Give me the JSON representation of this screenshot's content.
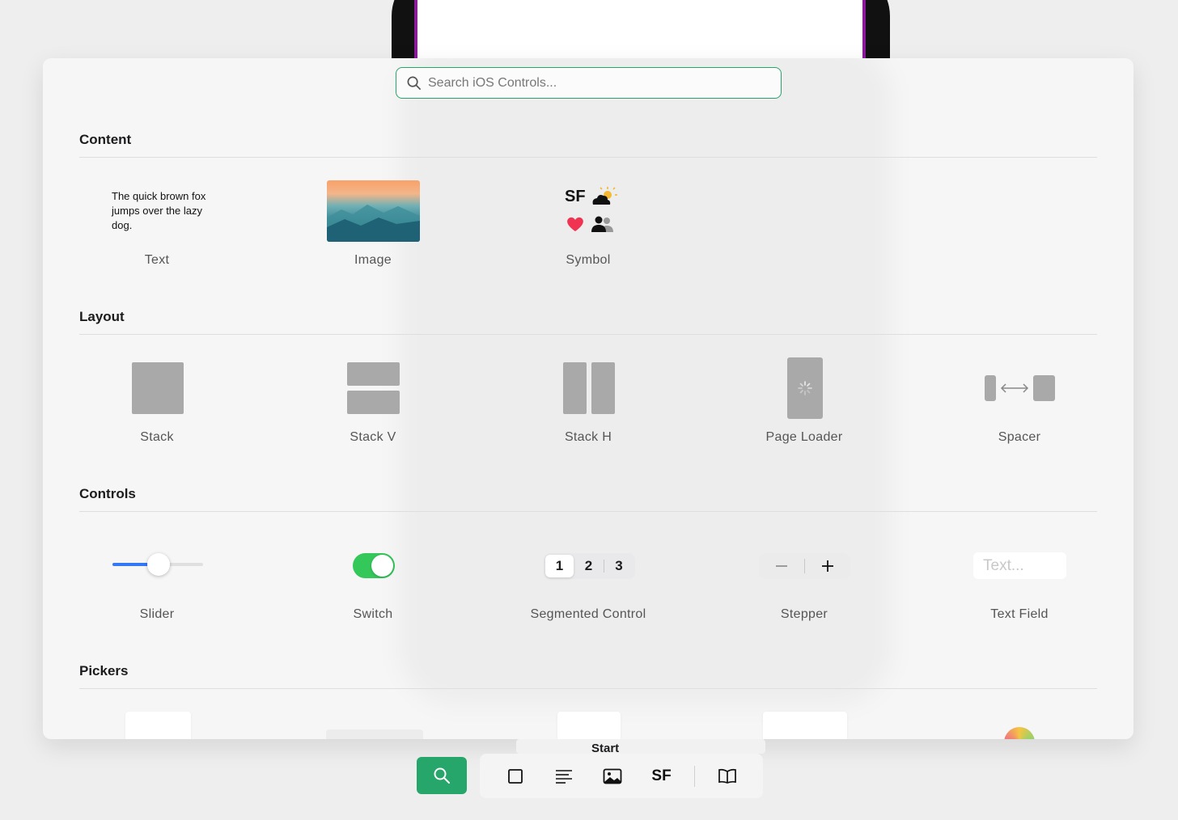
{
  "search": {
    "placeholder": "Search iOS Controls..."
  },
  "sections": {
    "content": "Content",
    "layout": "Layout",
    "controls": "Controls",
    "pickers": "Pickers"
  },
  "content": {
    "sample_text": "The quick brown fox jumps over the lazy dog.",
    "symbol_sf": "SF",
    "labels": [
      "Text",
      "Image",
      "Symbol"
    ]
  },
  "layout": {
    "labels": [
      "Stack",
      "Stack V",
      "Stack H",
      "Page Loader",
      "Spacer"
    ]
  },
  "controls": {
    "labels": [
      "Slider",
      "Switch",
      "Segmented Control",
      "Stepper",
      "Text Field"
    ],
    "segments": [
      "1",
      "2",
      "3"
    ],
    "textfield_placeholder": "Text...",
    "slider_value": 0.5,
    "switch_on": true
  },
  "mini_toolbar": {
    "start_label": "Start"
  },
  "bottom_toolbar": {
    "sf_label": "SF"
  },
  "colors": {
    "accent": "#27a66b",
    "slider": "#3478f6",
    "switch": "#34c759"
  }
}
